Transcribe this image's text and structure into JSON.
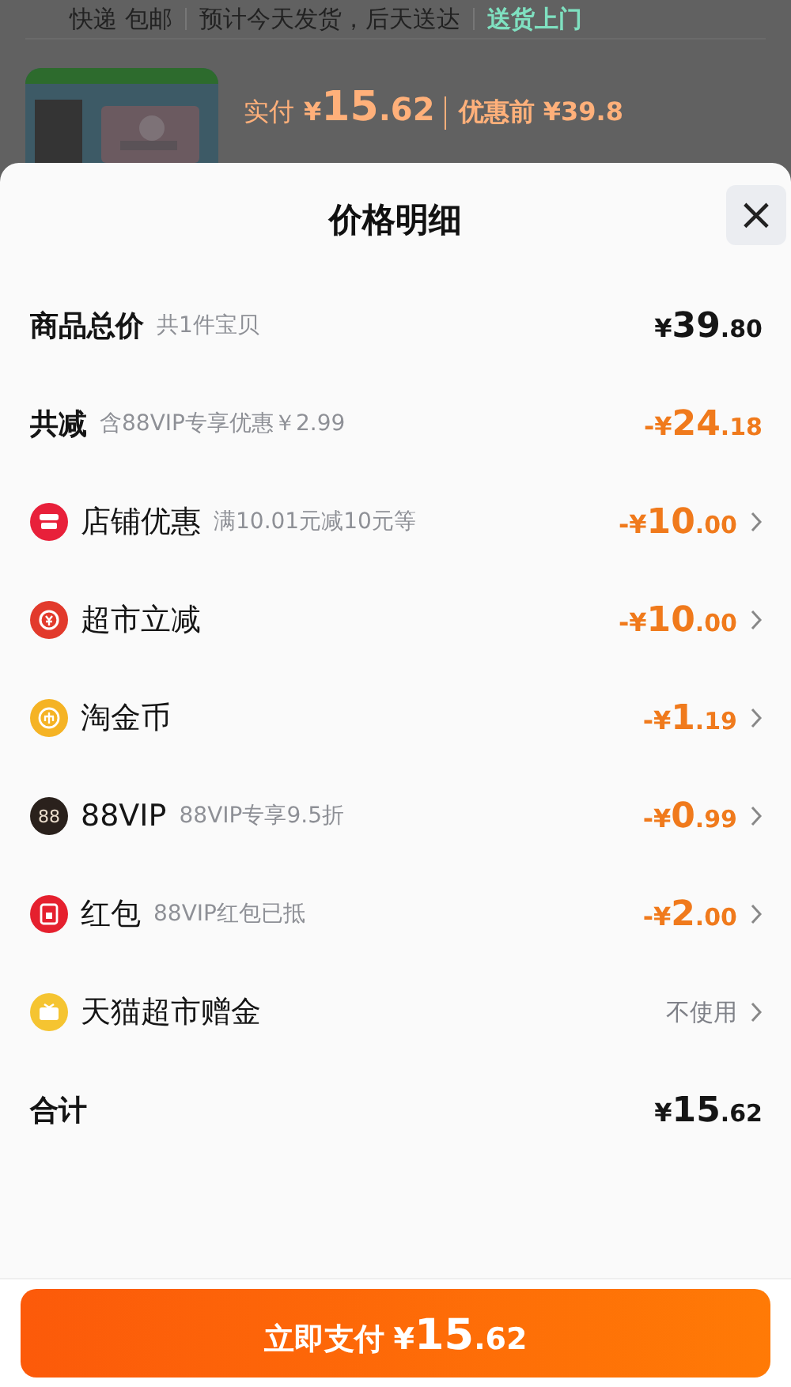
{
  "background": {
    "shipping": [
      {
        "text": "快递 包邮",
        "kind": "plain"
      },
      {
        "text": "预计今天发货，后天送达",
        "kind": "plain"
      },
      {
        "text": "送货上门",
        "kind": "highlight"
      }
    ],
    "product": {
      "paid_label": "实付",
      "price": {
        "sign": "¥",
        "int": "15",
        "dec": ".62"
      },
      "before": "优惠前 ¥39.8"
    }
  },
  "sheet": {
    "title": "价格明细",
    "close": "×",
    "rows": [
      {
        "kind": "total",
        "label": "商品总价",
        "note": "共1件宝贝",
        "amount": {
          "sign": "¥",
          "int": "39",
          "dec": ".80"
        },
        "arrow": false
      },
      {
        "kind": "summary",
        "label": "共减",
        "note": "含88VIP专享优惠￥2.99",
        "amount": {
          "sign": "-¥",
          "int": "24",
          "dec": ".18"
        },
        "arrow": false
      },
      {
        "kind": "shop",
        "color": "#e8203a",
        "label": "店铺优惠",
        "note": "满10.01元减10元等",
        "amount": {
          "sign": "-¥",
          "int": "10",
          "dec": ".00"
        },
        "arrow": true
      },
      {
        "kind": "instant",
        "color": "#e23a2c",
        "label": "超市立减",
        "amount": {
          "sign": "-¥",
          "int": "10",
          "dec": ".00"
        },
        "arrow": true
      },
      {
        "kind": "coin",
        "color": "#f5b324",
        "label": "淘金币",
        "amount": {
          "sign": "-¥",
          "int": "1",
          "dec": ".19"
        },
        "arrow": true
      },
      {
        "kind": "vip",
        "color": "#2a211c",
        "badge": "88",
        "label": "88VIP",
        "note": "88VIP专享9.5折",
        "amount": {
          "sign": "-¥",
          "int": "0",
          "dec": ".99"
        },
        "arrow": true
      },
      {
        "kind": "packet",
        "color": "#e5202e",
        "label": "红包",
        "note": "88VIP红包已抵",
        "amount": {
          "sign": "-¥",
          "int": "2",
          "dec": ".00"
        },
        "arrow": true
      },
      {
        "kind": "gift",
        "color": "#f5c431",
        "label": "天猫超市赠金",
        "value": "不使用",
        "arrow": true
      },
      {
        "kind": "total",
        "label": "合计",
        "amount": {
          "sign": "¥",
          "int": "15",
          "dec": ".62"
        },
        "arrow": false
      }
    ],
    "pay_button": {
      "label": "立即支付",
      "price": {
        "sign": "¥",
        "int": "15",
        "dec": ".62"
      }
    }
  }
}
